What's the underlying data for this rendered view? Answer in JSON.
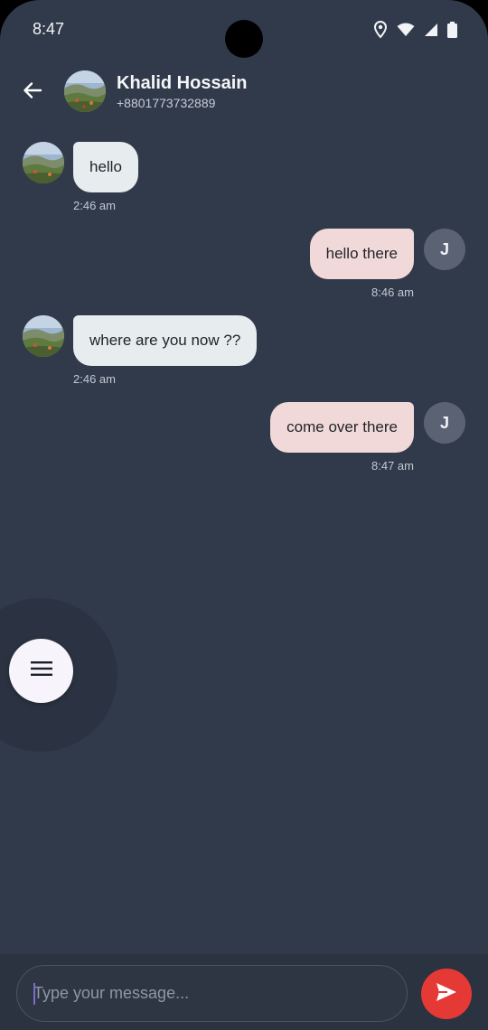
{
  "status_bar": {
    "time": "8:47"
  },
  "header": {
    "contact_name": "Khalid Hossain",
    "contact_phone": "+8801773732889"
  },
  "messages": [
    {
      "direction": "in",
      "text": "hello",
      "time": "2:46 am"
    },
    {
      "direction": "out",
      "text": "hello there",
      "time": "8:46 am",
      "avatar_initial": "J"
    },
    {
      "direction": "in",
      "text": "where are you now ??",
      "time": "2:46 am"
    },
    {
      "direction": "out",
      "text": "come over there",
      "time": "8:47 am",
      "avatar_initial": "J"
    }
  ],
  "composer": {
    "placeholder": "Type your message...",
    "value": ""
  },
  "icons": {
    "back": "arrow-left-icon",
    "menu": "hamburger-menu-icon",
    "send": "send-icon",
    "location": "location-pin-icon",
    "wifi": "wifi-icon",
    "signal": "signal-icon",
    "battery": "battery-icon"
  },
  "colors": {
    "background": "#313a4a",
    "incoming_bubble": "#e7ecee",
    "outgoing_bubble": "#f2d9d9",
    "send_button": "#e53935",
    "initial_avatar": "#5a6273"
  }
}
